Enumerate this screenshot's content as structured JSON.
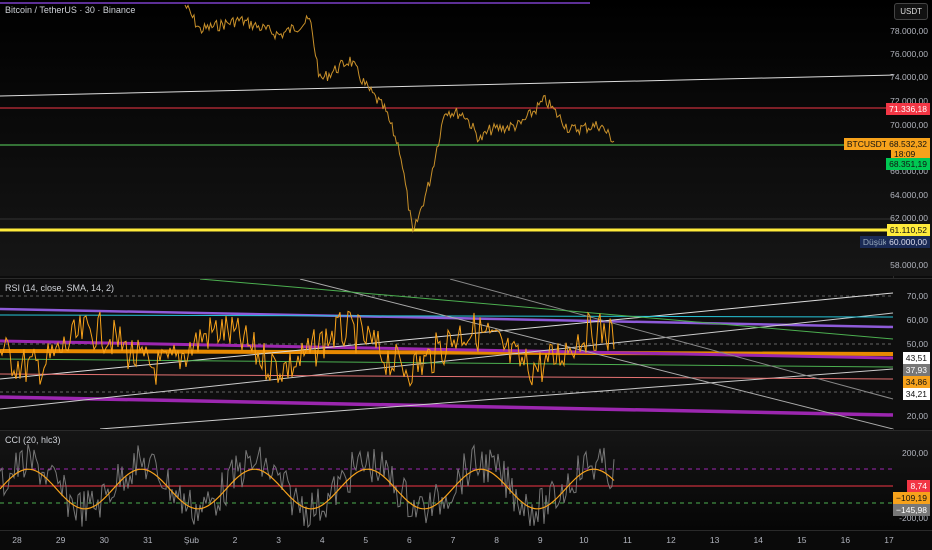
{
  "header": {
    "title": "Bitcoin / TetherUS · 30 · Binance",
    "currency": "USDT"
  },
  "price_axis": {
    "ticks": [
      "78.000,00",
      "76.000,00",
      "74.000,00",
      "72.000,00",
      "70.000,00",
      "66.000,00",
      "64.000,00",
      "62.000,00",
      "58.000,00"
    ],
    "tags": {
      "resistance": "71.336,18",
      "symbol": "BTCUSDT",
      "last": "68.532,32",
      "countdown": "18:09",
      "support": "68.351,19",
      "yellow": "61.110,52",
      "low_label": "Düşük",
      "low": "60.000,00"
    }
  },
  "rsi": {
    "title": "RSI (14, close, SMA, 14, 2)",
    "ticks": [
      "70,00",
      "60,00",
      "50,00",
      "20,00"
    ],
    "tags": [
      "43,51",
      "37,93",
      "34,86",
      "34,21"
    ]
  },
  "cci": {
    "title": "CCI (20, hlc3)",
    "ticks": [
      "200,00",
      "-200,00"
    ],
    "tags": [
      "8,74",
      "−109,19",
      "−145,98"
    ]
  },
  "time_axis": [
    "28",
    "29",
    "30",
    "31",
    "Şub",
    "2",
    "3",
    "4",
    "5",
    "6",
    "7",
    "8",
    "9",
    "10",
    "11",
    "12",
    "13",
    "14",
    "15",
    "16",
    "17"
  ],
  "colors": {
    "up": "#f7a21b",
    "red": "#f23645",
    "green": "#22ab94",
    "yellow": "#ffeb3b",
    "purple": "#9c27b0"
  }
}
